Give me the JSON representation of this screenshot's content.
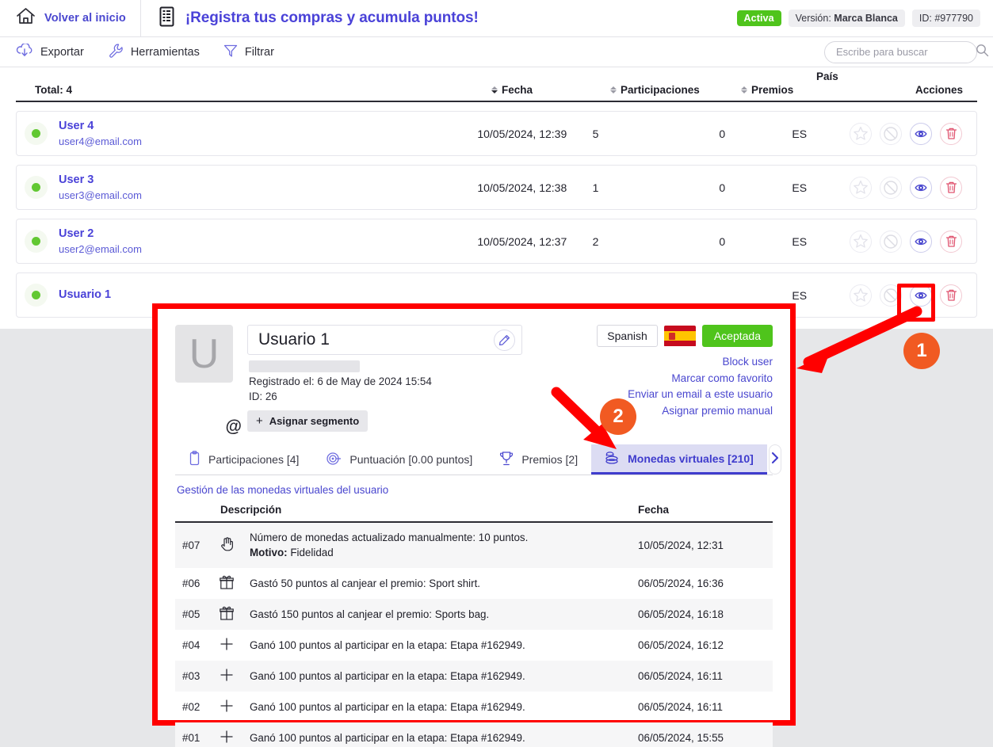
{
  "header": {
    "home_label": "Volver al inicio",
    "promo_title": "¡Registra tus compras y acumula puntos!",
    "status_badge": "Activa",
    "version_prefix": "Versión: ",
    "version_value": "Marca Blanca",
    "id_label": "ID: #977790",
    "accent_color": "#4a42d8",
    "green_color": "#4fc41c"
  },
  "toolbar": {
    "export_label": "Exportar",
    "tools_label": "Herramientas",
    "filter_label": "Filtrar",
    "search_placeholder": "Escribe para buscar",
    "search_value": ""
  },
  "table": {
    "total_label": "Total: 4",
    "columns": {
      "fecha": "Fecha",
      "participaciones": "Participaciones",
      "premios": "Premios",
      "pais": "País",
      "acciones": "Acciones"
    },
    "rows": [
      {
        "name": "User 4",
        "email": "user4@email.com",
        "fecha": "10/05/2024, 12:39",
        "participaciones": "5",
        "premios": "0",
        "pais": "ES",
        "status": "online"
      },
      {
        "name": "User 3",
        "email": "user3@email.com",
        "fecha": "10/05/2024, 12:38",
        "participaciones": "1",
        "premios": "0",
        "pais": "ES",
        "status": "online"
      },
      {
        "name": "User 2",
        "email": "user2@email.com",
        "fecha": "10/05/2024, 12:37",
        "participaciones": "2",
        "premios": "0",
        "pais": "ES",
        "status": "online"
      },
      {
        "name": "Usuario 1",
        "email": "",
        "fecha": "",
        "participaciones": "",
        "premios": "",
        "pais": "ES",
        "status": "online"
      }
    ]
  },
  "modal": {
    "avatar_letter": "U",
    "name_value": "Usuario 1",
    "registered_label": "Registrado el: 6 de May de 2024 15:54",
    "id_label": "ID: 26",
    "segment_button": "Asignar segmento",
    "language_button": "Spanish",
    "flag": "spain-flag",
    "status_button": "Aceptada",
    "links": [
      "Block user",
      "Marcar como favorito",
      "Enviar un email a este usuario",
      "Asignar premio manual"
    ],
    "tabs": [
      {
        "label": "Participaciones [4]",
        "icon": "clipboard-icon",
        "active": false
      },
      {
        "label": "Puntuación [0.00 puntos]",
        "icon": "target-icon",
        "active": false
      },
      {
        "label": "Premios [2]",
        "icon": "trophy-icon",
        "active": false
      },
      {
        "label": "Monedas virtuales [210]",
        "icon": "coins-icon",
        "active": true
      }
    ],
    "subtitle": "Gestión de las monedas virtuales del usuario",
    "inner_table": {
      "columns": {
        "descripcion": "Descripción",
        "fecha": "Fecha"
      },
      "rows": [
        {
          "id": "#07",
          "icon": "hand-icon",
          "desc": "Número de monedas actualizado manualmente: 10 puntos.",
          "desc_extra_label": "Motivo:",
          "desc_extra_value": " Fidelidad",
          "fecha": "10/05/2024, 12:31"
        },
        {
          "id": "#06",
          "icon": "gift-icon",
          "desc": "Gastó 50 puntos al canjear el premio: Sport shirt.",
          "desc_extra_label": "",
          "desc_extra_value": "",
          "fecha": "06/05/2024, 16:36"
        },
        {
          "id": "#05",
          "icon": "gift-icon",
          "desc": "Gastó 150 puntos al canjear el premio: Sports bag.",
          "desc_extra_label": "",
          "desc_extra_value": "",
          "fecha": "06/05/2024, 16:18"
        },
        {
          "id": "#04",
          "icon": "plus-icon",
          "desc": "Ganó 100 puntos al participar en la etapa: Etapa #162949.",
          "desc_extra_label": "",
          "desc_extra_value": "",
          "fecha": "06/05/2024, 16:12"
        },
        {
          "id": "#03",
          "icon": "plus-icon",
          "desc": "Ganó 100 puntos al participar en la etapa: Etapa #162949.",
          "desc_extra_label": "",
          "desc_extra_value": "",
          "fecha": "06/05/2024, 16:11"
        },
        {
          "id": "#02",
          "icon": "plus-icon",
          "desc": "Ganó 100 puntos al participar en la etapa: Etapa #162949.",
          "desc_extra_label": "",
          "desc_extra_value": "",
          "fecha": "06/05/2024, 16:11"
        },
        {
          "id": "#01",
          "icon": "plus-icon",
          "desc": "Ganó 100 puntos al participar en la etapa: Etapa #162949.",
          "desc_extra_label": "",
          "desc_extra_value": "",
          "fecha": "06/05/2024, 15:55"
        }
      ]
    }
  },
  "annotations": {
    "marker_1": "1",
    "marker_2": "2",
    "highlight_color": "#ff0000",
    "marker_color": "#f15a22"
  }
}
